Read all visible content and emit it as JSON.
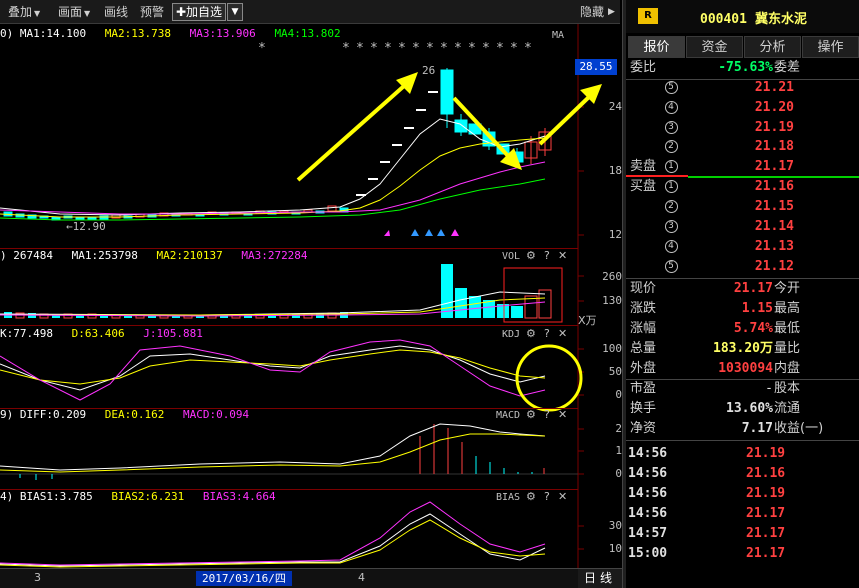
{
  "toolbar": {
    "items": [
      "叠加",
      "画面",
      "画线",
      "预警"
    ],
    "add_watch": "✚加自选",
    "hide": "隐藏",
    "dropdown_arrow": "▼"
  },
  "main_chart": {
    "legend": [
      {
        "text": "0) MA1:14.100",
        "color": "#ffffff"
      },
      {
        "text": "MA2:13.738",
        "color": "#ffff00"
      },
      {
        "text": "MA3:13.906",
        "color": "#ff33ff"
      },
      {
        "text": "MA4:13.802",
        "color": "#00ff00"
      }
    ],
    "tag": "MA",
    "price_tag": "28.55",
    "axis": [
      "24",
      "18",
      "12"
    ],
    "high_label": "26",
    "low_label": "12.90"
  },
  "vol_chart": {
    "legend": [
      {
        "text": ") 267484",
        "color": "#ffffff"
      },
      {
        "text": "MA1:253798",
        "color": "#ffffff"
      },
      {
        "text": "MA2:210137",
        "color": "#ffff00"
      },
      {
        "text": "MA3:272284",
        "color": "#ff33ff"
      }
    ],
    "tag": "VOL",
    "axis": [
      "260",
      "130"
    ],
    "unit": "X万"
  },
  "kdj_chart": {
    "legend": [
      {
        "text": "K:77.498",
        "color": "#ffffff"
      },
      {
        "text": "D:63.406",
        "color": "#ffff00"
      },
      {
        "text": "J:105.881",
        "color": "#ff33ff"
      }
    ],
    "tag": "KDJ",
    "axis": [
      "100",
      "50",
      "0"
    ]
  },
  "macd_chart": {
    "legend": [
      {
        "text": "9) DIFF:0.209",
        "color": "#ffffff"
      },
      {
        "text": "DEA:0.162",
        "color": "#ffff00"
      },
      {
        "text": "MACD:0.094",
        "color": "#ff33ff"
      }
    ],
    "tag": "MACD",
    "axis": [
      "2",
      "1",
      "0"
    ]
  },
  "bias_chart": {
    "legend": [
      {
        "text": "4) BIAS1:3.785",
        "color": "#ffffff"
      },
      {
        "text": "BIAS2:6.231",
        "color": "#ffff00"
      },
      {
        "text": "BIAS3:4.664",
        "color": "#ff33ff"
      }
    ],
    "tag": "BIAS",
    "axis": [
      "30",
      "10"
    ]
  },
  "pane_controls": {
    "gear": "⚙",
    "help": "?",
    "close": "✕"
  },
  "bottom": {
    "date": "2017/03/16/四",
    "month_left": "3",
    "month_right": "4",
    "line_btn": "日线"
  },
  "stock": {
    "badge": "R",
    "code": "000401",
    "name": "冀东水泥"
  },
  "tabs": [
    "报价",
    "资金",
    "分析",
    "操作"
  ],
  "weibi": {
    "label": "委比",
    "value": "-75.63%",
    "label2": "委差"
  },
  "sell": {
    "label": "卖盘",
    "levels": [
      {
        "n": "5",
        "price": "21.21"
      },
      {
        "n": "4",
        "price": "21.20"
      },
      {
        "n": "3",
        "price": "21.19"
      },
      {
        "n": "2",
        "price": "21.18"
      },
      {
        "n": "1",
        "price": "21.17"
      }
    ]
  },
  "buy": {
    "label": "买盘",
    "levels": [
      {
        "n": "1",
        "price": "21.16"
      },
      {
        "n": "2",
        "price": "21.15"
      },
      {
        "n": "3",
        "price": "21.14"
      },
      {
        "n": "4",
        "price": "21.13"
      },
      {
        "n": "5",
        "price": "21.12"
      }
    ]
  },
  "quote": [
    {
      "label": "现价",
      "value": "21.17",
      "color": "#ff4040",
      "label2": "今开"
    },
    {
      "label": "涨跌",
      "value": "1.15",
      "color": "#ff4040",
      "label2": "最高"
    },
    {
      "label": "涨幅",
      "value": "5.74%",
      "color": "#ff4040",
      "label2": "最低"
    },
    {
      "label": "总量",
      "value": "183.20万",
      "color": "#ffff66",
      "label2": "量比"
    },
    {
      "label": "外盘",
      "value": "1030094",
      "color": "#ff4040",
      "label2": "内盘"
    }
  ],
  "fund": [
    {
      "label": "市盈",
      "value": "-",
      "color": "#e0e0e0",
      "label2": "股本"
    },
    {
      "label": "换手",
      "value": "13.60%",
      "color": "#e0e0e0",
      "label2": "流通"
    },
    {
      "label": "净资",
      "value": "7.17",
      "color": "#e0e0e0",
      "label2": "收益(一)"
    }
  ],
  "ticks": [
    {
      "time": "14:56",
      "price": "21.19"
    },
    {
      "time": "14:56",
      "price": "21.16"
    },
    {
      "time": "14:56",
      "price": "21.19"
    },
    {
      "time": "14:56",
      "price": "21.17"
    },
    {
      "time": "14:57",
      "price": "21.17"
    },
    {
      "time": "15:00",
      "price": "21.17"
    }
  ]
}
